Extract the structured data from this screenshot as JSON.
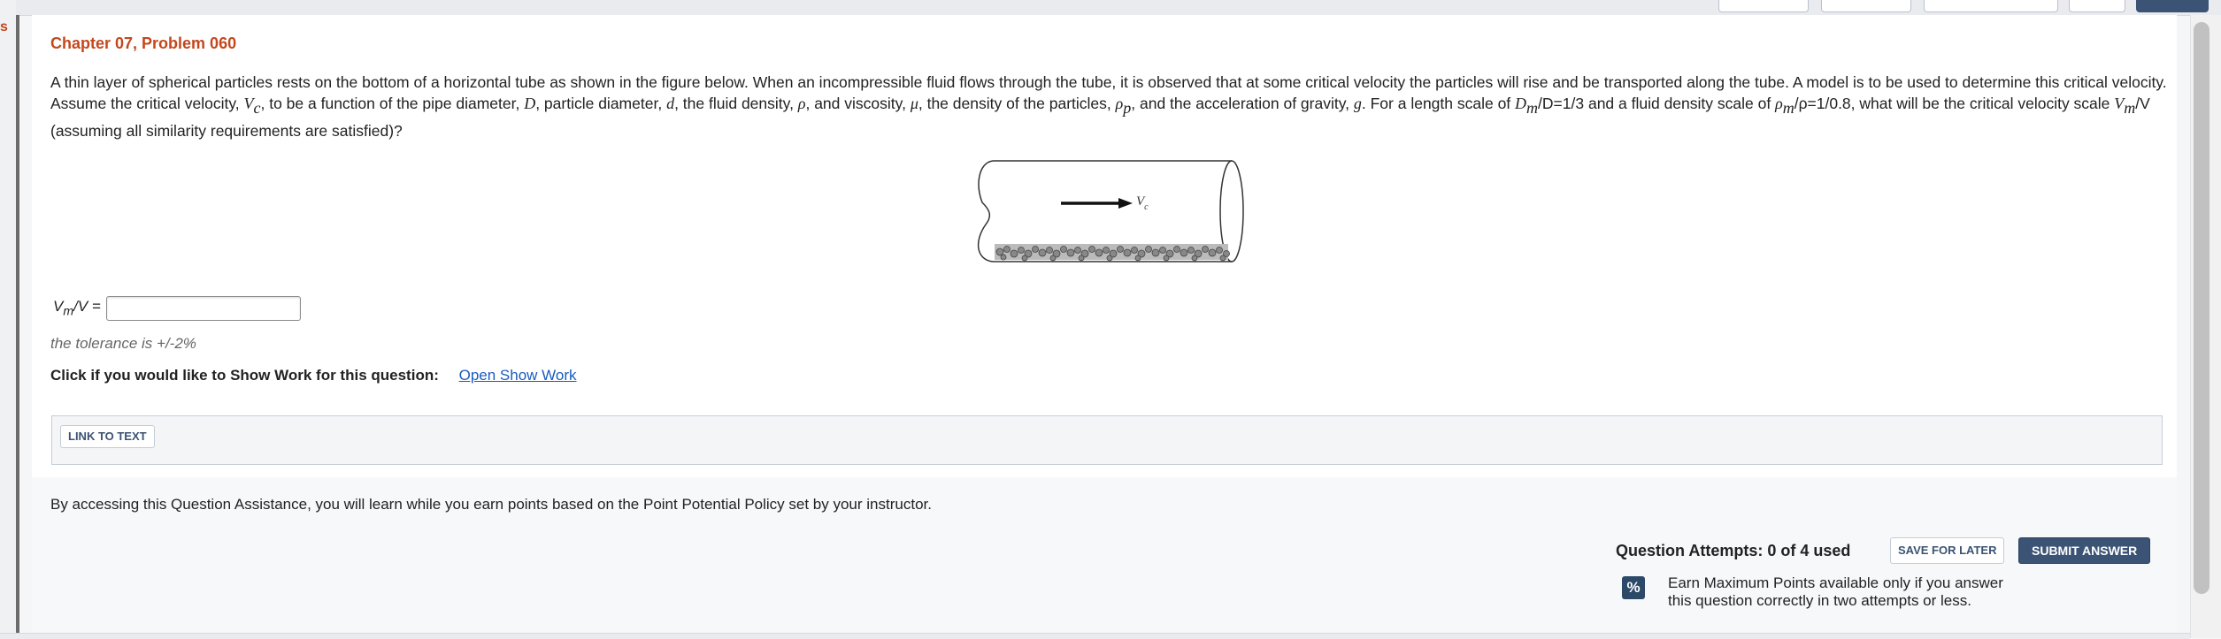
{
  "problem": {
    "title": "Chapter 07, Problem 060",
    "q_before_vc": "A thin layer of spherical particles rests on the bottom of a horizontal tube as shown in the figure below. When an incompressible fluid flows through the tube, it is observed that at some critical velocity the particles will rise and be transported along the tube. A model is to be used to determine this critical velocity. Assume the critical velocity, ",
    "vc_main": "V",
    "vc_sub": "c",
    "q_after_vc": ", to be a function of the pipe diameter, ",
    "sym_D": "D",
    "q_particle": ", particle diameter, ",
    "sym_d": "d",
    "q_density": ", the fluid density, ",
    "sym_rho": "ρ",
    "q_visc": ", and viscosity, ",
    "sym_mu": "μ",
    "q_partdens": ", the density of the particles, ",
    "rhop_main": "ρ",
    "rhop_sub": "p",
    "q_gravity": ", and the acceleration of gravity, ",
    "sym_g": "g",
    "q_length": ". For a length scale of ",
    "dm_main": "D",
    "dm_sub": "m",
    "dm_tail": "/D=1/3 and a fluid density scale of ",
    "rhom_main": "ρ",
    "rhom_sub": "m",
    "rhom_tail": "/ρ=1/0.8, what will be the critical velocity scale ",
    "vm_main": "V",
    "vm_sub": "m",
    "vm_tail": "/V",
    "q_end": " (assuming all similarity requirements are satisfied)?"
  },
  "figure": {
    "label_main": "V",
    "label_sub": "c"
  },
  "answer": {
    "label_main": "V",
    "label_sub": "m",
    "label_tail": "/V =",
    "value": "",
    "tolerance": "the tolerance is +/-2%"
  },
  "show_work": {
    "prompt": "Click if you would like to Show Work for this question:",
    "link": "Open Show Work"
  },
  "link_to_text": "LINK TO TEXT",
  "assistance": "By accessing this Question Assistance, you will learn while you earn points based on the Point Potential Policy set by your instructor.",
  "attempts": "Question Attempts: 0 of 4 used",
  "buttons": {
    "save": "SAVE FOR LATER",
    "submit": "SUBMIT ANSWER"
  },
  "earn_icon": "%",
  "earn_text": "Earn Maximum Points available only if you answer this question correctly in two attempts or less.",
  "colors": {
    "title": "#c4471c",
    "button_dark": "#3b5374",
    "link": "#1a5cc0"
  },
  "left_rail_letter": "s"
}
